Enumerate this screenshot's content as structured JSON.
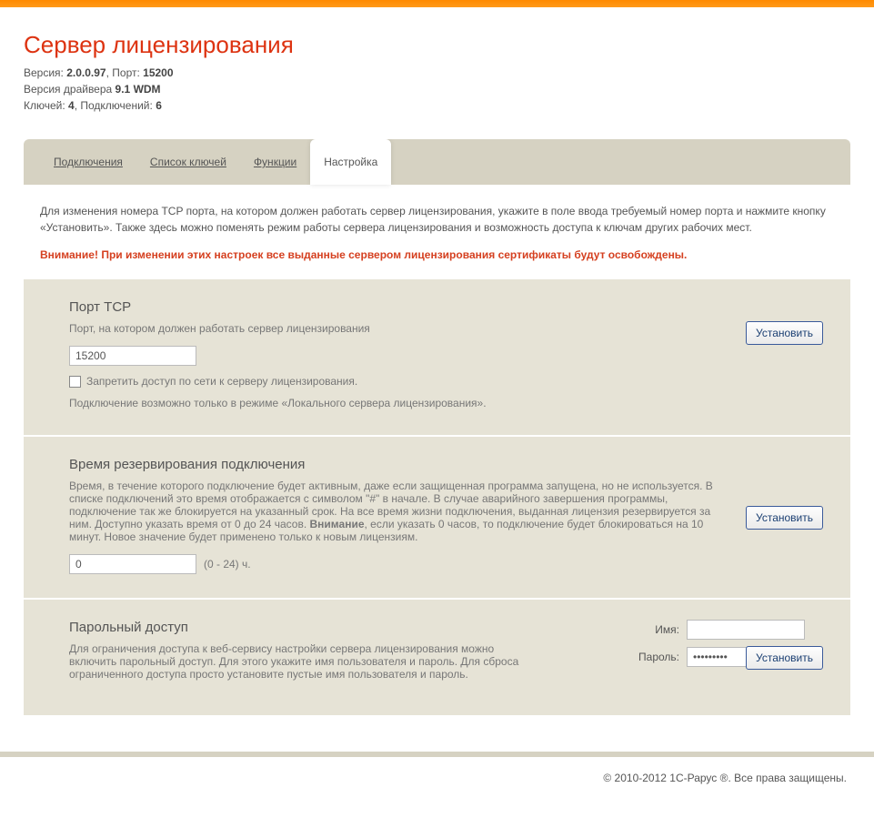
{
  "topbar": {},
  "header": {
    "title": "Сервер лицензирования",
    "line1_prefix": "Версия: ",
    "line1_version": "2.0.0.97",
    "line1_port_label": ", Порт: ",
    "line1_port": "15200",
    "line2_prefix": "Версия драйвера ",
    "line2_value": "9.1 WDM",
    "line3_prefix": "Ключей: ",
    "line3_keys": "4",
    "line3_conn_label": ", Подключений: ",
    "line3_conns": "6"
  },
  "tabs": {
    "connections": "Подключения",
    "keys": "Список ключей",
    "functions": "Функции",
    "settings": "Настройка"
  },
  "intro": {
    "text": "Для изменения номера TCP порта, на котором должен работать сервер лицензирования, укажите в поле ввода требуемый номер порта и нажмите кнопку «Установить». Также здесь можно поменять режим работы сервера лицензирования и возможность доступа к ключам других рабочих мест.",
    "warning": "Внимание! При изменении этих настроек все выданные сервером лицензирования сертификаты будут освобождены."
  },
  "port": {
    "title": "Порт TCP",
    "desc": "Порт, на котором должен работать сервер лицензирования",
    "value": "15200",
    "btn": "Установить",
    "check_label": "Запретить доступ по сети к серверу лицензирования.",
    "check_note": "Подключение возможно только в режиме «Локального сервера лицензирования»."
  },
  "reserve": {
    "title": "Время резервирования подключения",
    "desc_p1": "Время, в течение которого подключение будет активным, даже если защищенная программа запущена, но не используется. В списке подключений это время отображается с символом \"#\" в начале. В случае аварийного завершения программы, подключение так же блокируется на указанный срок. На все время жизни подключения, выданная лицензия резервируется за ним. Доступно указать время от 0 до 24 часов. ",
    "desc_bold": "Внимание",
    "desc_p2": ", если указать 0 часов, то подключение будет блокироваться на 10 минут. Новое значение будет применено только к новым лицензиям.",
    "value": "0",
    "hint": "(0 - 24) ч.",
    "btn": "Установить"
  },
  "auth": {
    "title": "Парольный доступ",
    "desc": "Для ограничения доступа к веб-сервису настройки сервера лицензирования можно включить парольный доступ. Для этого укажите имя пользователя и пароль. Для сброса ограниченного доступа просто установите пустые имя пользователя и пароль.",
    "name_label": "Имя:",
    "name_value": "",
    "pass_label": "Пароль:",
    "pass_value": "•••••••••",
    "btn": "Установить"
  },
  "footer": {
    "text": "© 2010-2012 1С-Рарус ®. Все права защищены."
  }
}
